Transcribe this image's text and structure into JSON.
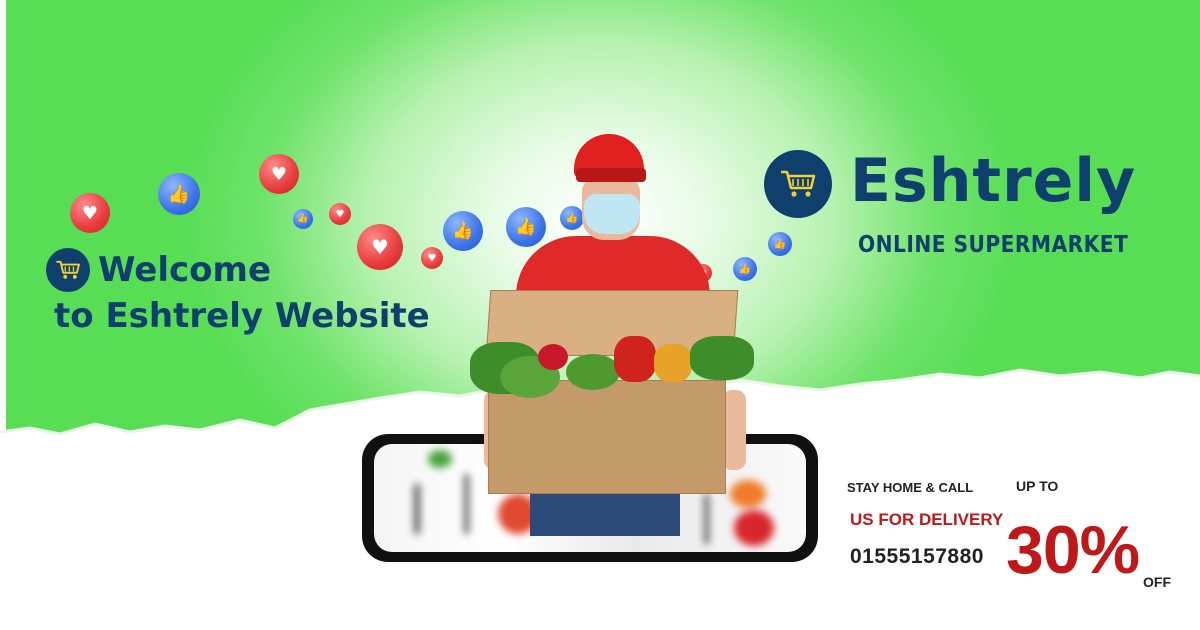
{
  "brand": {
    "name": "Eshtrely",
    "tagline": "ONLINE SUPERMARKET"
  },
  "welcome": {
    "line1": "Welcome",
    "line2": "to Eshtrely Website"
  },
  "promo": {
    "stay_home": "STAY HOME & CALL",
    "delivery": "US FOR DELIVERY",
    "phone": "01555157880",
    "up_to": "UP TO",
    "discount": "30%",
    "off": "OFF"
  },
  "colors": {
    "brand_blue": "#0e3f6d",
    "accent_red": "#c01818",
    "green": "#57de55"
  },
  "icons": [
    "shopping-cart-icon",
    "heart-reaction-icon",
    "thumbs-up-reaction-icon"
  ]
}
